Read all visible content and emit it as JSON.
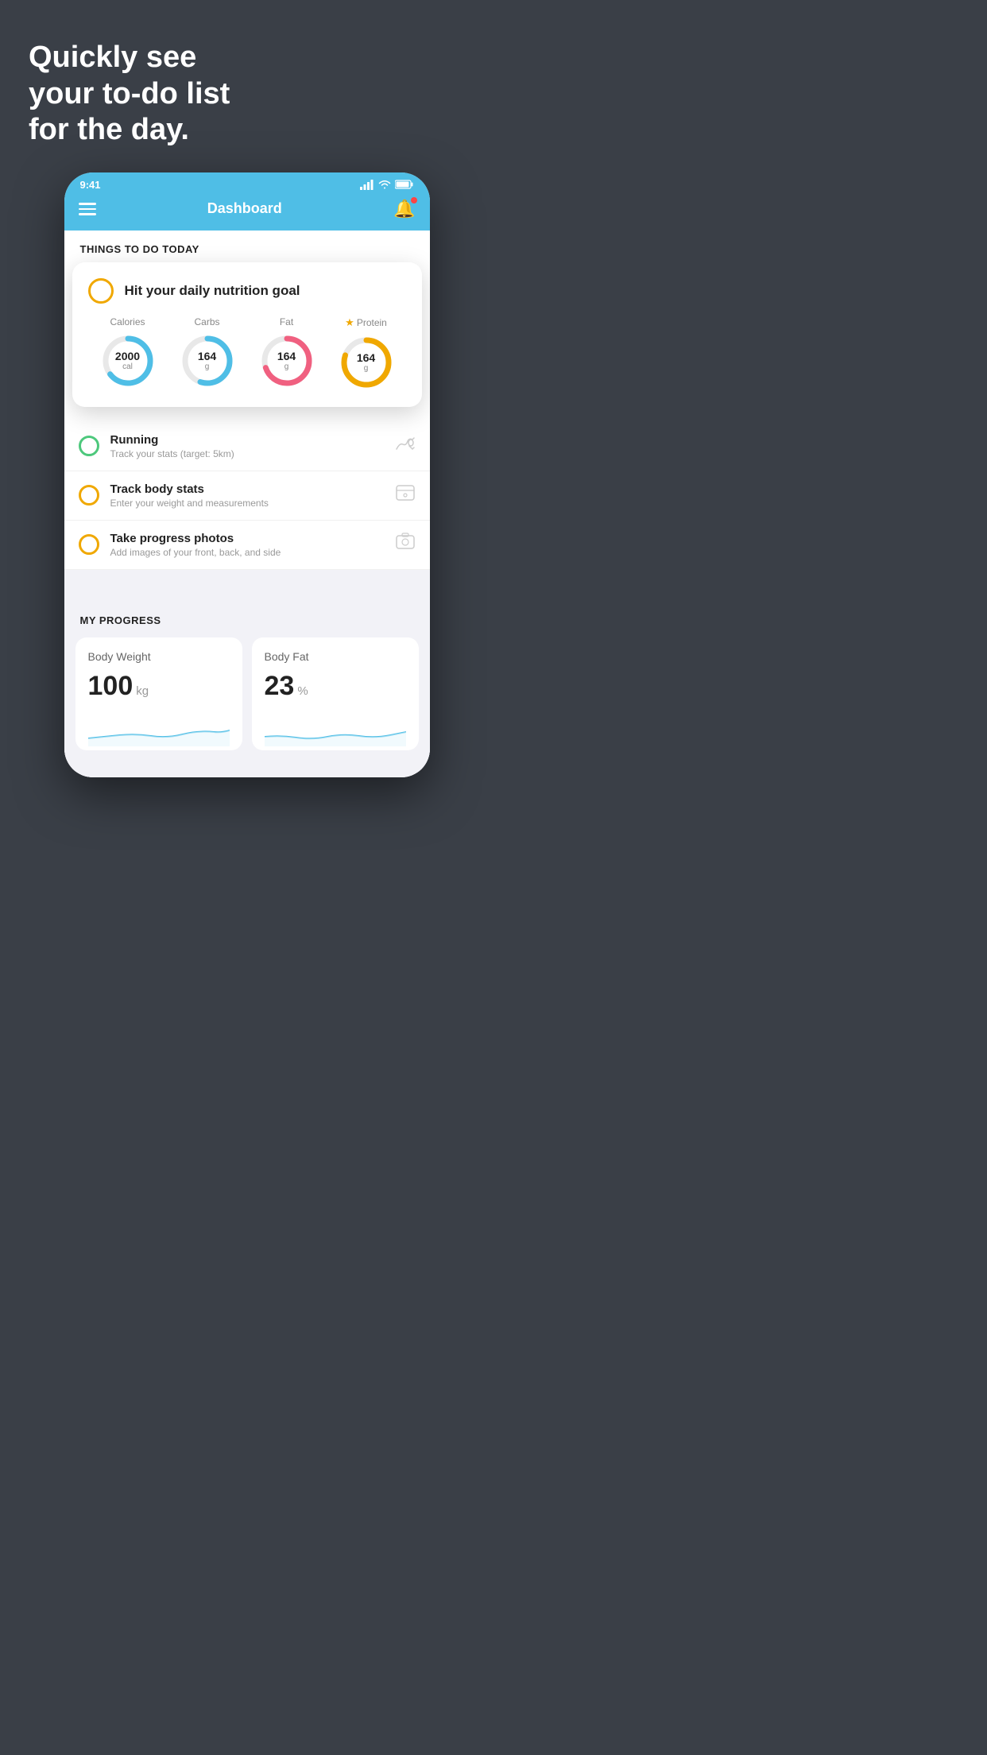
{
  "hero": {
    "line1": "Quickly see",
    "line2": "your to-do list",
    "line3": "for the day."
  },
  "phone": {
    "status": {
      "time": "9:41"
    },
    "navbar": {
      "title": "Dashboard"
    },
    "section1": {
      "title": "THINGS TO DO TODAY"
    },
    "floating_card": {
      "title": "Hit your daily nutrition goal",
      "items": [
        {
          "label": "Calories",
          "value": "2000",
          "unit": "cal",
          "color": "#4fbee6",
          "pct": 65
        },
        {
          "label": "Carbs",
          "value": "164",
          "unit": "g",
          "color": "#4fbee6",
          "pct": 55
        },
        {
          "label": "Fat",
          "value": "164",
          "unit": "g",
          "color": "#f06080",
          "pct": 70
        },
        {
          "label": "Protein",
          "value": "164",
          "unit": "g",
          "color": "#f0a800",
          "pct": 80,
          "starred": true
        }
      ]
    },
    "todo_items": [
      {
        "title": "Running",
        "subtitle": "Track your stats (target: 5km)",
        "circle": "green",
        "icon": "👟"
      },
      {
        "title": "Track body stats",
        "subtitle": "Enter your weight and measurements",
        "circle": "yellow",
        "icon": "⚖️"
      },
      {
        "title": "Take progress photos",
        "subtitle": "Add images of your front, back, and side",
        "circle": "yellow",
        "icon": "🖼️"
      }
    ],
    "progress": {
      "title": "MY PROGRESS",
      "cards": [
        {
          "title": "Body Weight",
          "value": "100",
          "unit": "kg"
        },
        {
          "title": "Body Fat",
          "value": "23",
          "unit": "%"
        }
      ]
    }
  }
}
